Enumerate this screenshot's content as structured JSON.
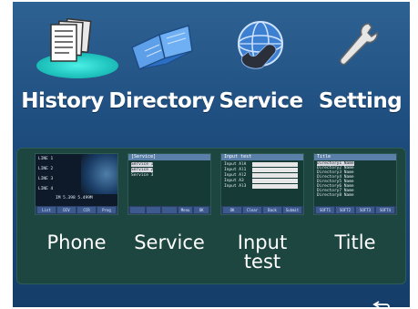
{
  "top_menu": [
    {
      "label": "History",
      "icon": "history-icon"
    },
    {
      "label": "Directory",
      "icon": "directory-icon"
    },
    {
      "label": "Service",
      "icon": "service-icon"
    },
    {
      "label": "Setting",
      "icon": "setting-icon"
    }
  ],
  "bottom_menu": [
    {
      "label": "Phone"
    },
    {
      "label": "Service"
    },
    {
      "label_line1": "Input",
      "label_line2": "test"
    },
    {
      "label": "Title"
    }
  ],
  "thumbs": {
    "phone": {
      "lines": [
        "LINE 1",
        "LINE 2",
        "LINE 3",
        "LINE 4"
      ],
      "status": "IM  5.398  5.499M",
      "foot": [
        "List",
        "DIV",
        "CCR",
        "Prog"
      ]
    },
    "service": {
      "header": "[Service]",
      "items": [
        "Service 1",
        "Service 2",
        "Service 3"
      ],
      "foot": [
        "",
        "",
        "",
        "Menu",
        "OK"
      ]
    },
    "input_test": {
      "header": "Input test",
      "fields": [
        "Input AlA",
        "Input Al1",
        "Input Al2",
        "Input A3",
        "Input Al3"
      ],
      "foot": [
        "OK",
        "Clear",
        "Back",
        "Submit"
      ]
    },
    "title": {
      "header": "Title",
      "items": [
        "Directory1 Name",
        "Directory2 Name",
        "Directory3 Name",
        "Directory4 Name",
        "Directory5 Name",
        "Directory6 Name",
        "Directory7 Name",
        "Directory8 Name"
      ],
      "foot": [
        "SOFT1",
        "SOFT2",
        "SOFT3",
        "SOFT4"
      ]
    }
  },
  "colors": {
    "background_top": "#2e6293",
    "background_bottom": "#153d69",
    "panel": "#1d4640",
    "highlight": "#22c6c0"
  }
}
